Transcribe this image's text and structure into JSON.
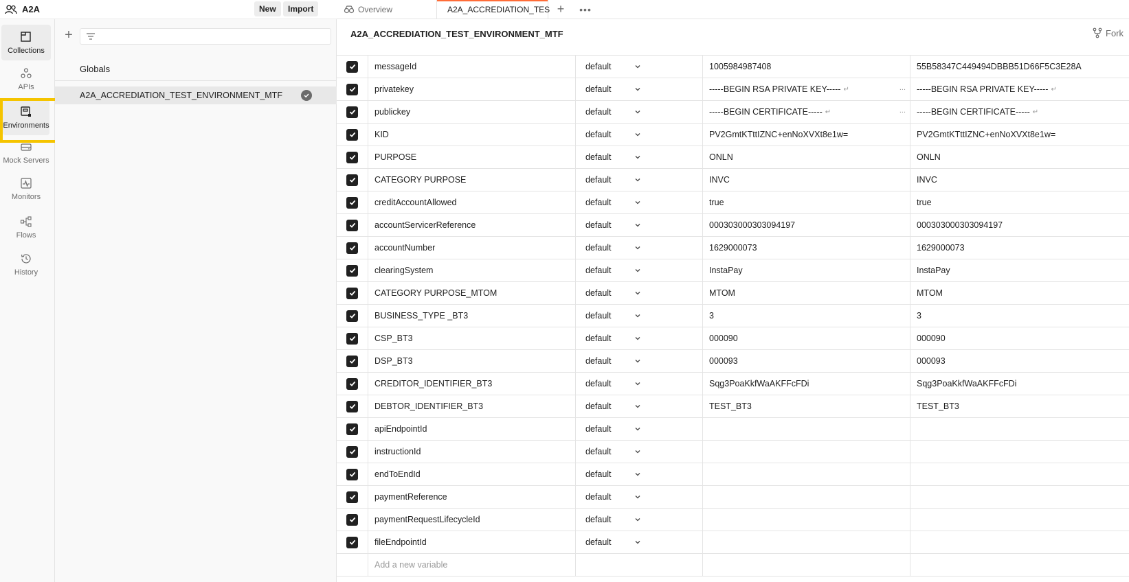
{
  "workspace": {
    "name": "A2A",
    "icon": "team-icon"
  },
  "header": {
    "new_label": "New",
    "import_label": "Import"
  },
  "tabs": [
    {
      "label": "Overview",
      "icon": "overview-icon",
      "active": false
    },
    {
      "label": "A2A_ACCREDIATION_TES",
      "icon": "environment-icon",
      "active": true
    }
  ],
  "rail": [
    {
      "label": "Collections",
      "icon": "collections-icon"
    },
    {
      "label": "APIs",
      "icon": "apis-icon"
    },
    {
      "label": "Environments",
      "icon": "environments-icon"
    },
    {
      "label": "Mock Servers",
      "icon": "mock-servers-icon"
    },
    {
      "label": "Monitors",
      "icon": "monitors-icon"
    },
    {
      "label": "Flows",
      "icon": "flows-icon"
    },
    {
      "label": "History",
      "icon": "history-icon"
    }
  ],
  "env_panel": {
    "globals_label": "Globals",
    "selected_env": "A2A_ACCREDIATION_TEST_ENVIRONMENT_MTF"
  },
  "main": {
    "title": "A2A_ACCREDIATION_TEST_ENVIRONMENT_MTF",
    "fork_label": "Fork",
    "add_placeholder": "Add a new variable",
    "variables": [
      {
        "name": "messageId",
        "type": "default",
        "initial": "1005984987408",
        "current": "55B58347C449494DBBB51D66F5C3E28A",
        "multiline": false
      },
      {
        "name": "privatekey",
        "type": "default",
        "initial": "-----BEGIN RSA PRIVATE KEY-----",
        "current": "-----BEGIN RSA PRIVATE KEY-----",
        "multiline": true
      },
      {
        "name": "publickey",
        "type": "default",
        "initial": "-----BEGIN CERTIFICATE-----",
        "current": "-----BEGIN CERTIFICATE-----",
        "multiline": true
      },
      {
        "name": "KID",
        "type": "default",
        "initial": "PV2GmtKTttIZNC+enNoXVXt8e1w=",
        "current": "PV2GmtKTttIZNC+enNoXVXt8e1w=",
        "multiline": false
      },
      {
        "name": "PURPOSE",
        "type": "default",
        "initial": "ONLN",
        "current": "ONLN",
        "multiline": false
      },
      {
        "name": "CATEGORY PURPOSE",
        "type": "default",
        "initial": "INVC",
        "current": "INVC",
        "multiline": false
      },
      {
        "name": "creditAccountAllowed",
        "type": "default",
        "initial": "true",
        "current": "true",
        "multiline": false
      },
      {
        "name": "accountServicerReference",
        "type": "default",
        "initial": "000303000303094197",
        "current": "000303000303094197",
        "multiline": false
      },
      {
        "name": "accountNumber",
        "type": "default",
        "initial": "1629000073",
        "current": "1629000073",
        "multiline": false
      },
      {
        "name": "clearingSystem",
        "type": "default",
        "initial": "InstaPay",
        "current": "InstaPay",
        "multiline": false
      },
      {
        "name": "CATEGORY PURPOSE_MTOM",
        "type": "default",
        "initial": "MTOM",
        "current": "MTOM",
        "multiline": false
      },
      {
        "name": "BUSINESS_TYPE _BT3",
        "type": "default",
        "initial": "3",
        "current": "3",
        "multiline": false
      },
      {
        "name": "CSP_BT3",
        "type": "default",
        "initial": "000090",
        "current": "000090",
        "multiline": false
      },
      {
        "name": "DSP_BT3",
        "type": "default",
        "initial": "000093",
        "current": "000093",
        "multiline": false
      },
      {
        "name": "CREDITOR_IDENTIFIER_BT3",
        "type": "default",
        "initial": "Sqg3PoaKkfWaAKFFcFDi",
        "current": "Sqg3PoaKkfWaAKFFcFDi",
        "multiline": false
      },
      {
        "name": "DEBTOR_IDENTIFIER_BT3",
        "type": "default",
        "initial": "TEST_BT3",
        "current": "TEST_BT3",
        "multiline": false
      },
      {
        "name": "apiEndpointId",
        "type": "default",
        "initial": "",
        "current": "",
        "multiline": false
      },
      {
        "name": "instructionId",
        "type": "default",
        "initial": "",
        "current": "",
        "multiline": false
      },
      {
        "name": "endToEndId",
        "type": "default",
        "initial": "",
        "current": "",
        "multiline": false
      },
      {
        "name": "paymentReference",
        "type": "default",
        "initial": "",
        "current": "",
        "multiline": false
      },
      {
        "name": "paymentRequestLifecycleId",
        "type": "default",
        "initial": "",
        "current": "",
        "multiline": false
      },
      {
        "name": "fileEndpointId",
        "type": "default",
        "initial": "",
        "current": "",
        "multiline": false
      }
    ]
  },
  "colors": {
    "highlight": "#f5c400",
    "accent": "#ff6c37"
  }
}
